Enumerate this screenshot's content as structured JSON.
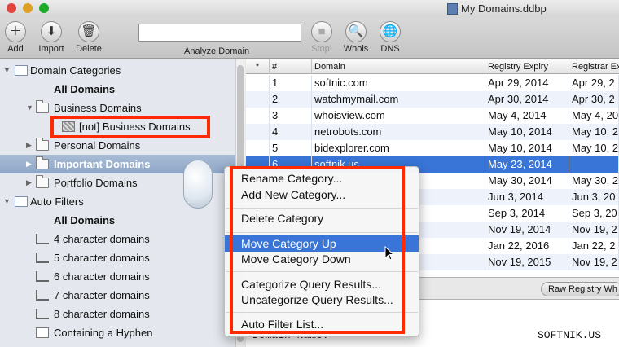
{
  "window": {
    "title": "My Domains.ddbp"
  },
  "toolbar": {
    "add_label": "Add",
    "import_label": "Import",
    "delete_label": "Delete",
    "analyze_value": "",
    "analyze_label": "Analyze Domain",
    "stop_label": "Stop!",
    "whois_label": "Whois",
    "dns_label": "DNS"
  },
  "sidebar": {
    "domain_categories": "Domain Categories",
    "all_domains": "All Domains",
    "business_domains": "Business Domains",
    "not_business_domains": "[not] Business Domains",
    "personal_domains": "Personal Domains",
    "important_domains": "Important Domains",
    "portfolio_domains": "Portfolio Domains",
    "auto_filters": "Auto Filters",
    "auto_all_domains": "All Domains",
    "four_char": "4 character domains",
    "five_char": "5 character domains",
    "six_char": "6 character domains",
    "seven_char": "7 character domains",
    "eight_char": "8 character domains",
    "hyphen": "Containing a Hyphen"
  },
  "table": {
    "headers": [
      "*",
      "#",
      "Domain",
      "Registry Expiry",
      "Registrar Ex"
    ],
    "rows": [
      {
        "num": "1",
        "domain": "softnic.com",
        "expiry": "Apr 29, 2014",
        "registrar": "Apr 29, 2"
      },
      {
        "num": "2",
        "domain": "watchmymail.com",
        "expiry": "Apr 30, 2014",
        "registrar": "Apr 30, 2"
      },
      {
        "num": "3",
        "domain": "whoisview.com",
        "expiry": "May 4, 2014",
        "registrar": "May 4, 20"
      },
      {
        "num": "4",
        "domain": "netrobots.com",
        "expiry": "May 10, 2014",
        "registrar": "May 10, 2"
      },
      {
        "num": "5",
        "domain": "bidexplorer.com",
        "expiry": "May 10, 2014",
        "registrar": "May 10, 2"
      },
      {
        "num": "6",
        "domain": "softnik.us",
        "expiry": "May 23, 2014",
        "registrar": ""
      },
      {
        "num": "",
        "domain": "",
        "expiry": "May 30, 2014",
        "registrar": "May 30, 2"
      },
      {
        "num": "",
        "domain": "",
        "expiry": "Jun 3, 2014",
        "registrar": "Jun 3, 20"
      },
      {
        "num": "",
        "domain": "",
        "expiry": "Sep 3, 2014",
        "registrar": "Sep 3, 20"
      },
      {
        "num": "",
        "domain": "",
        "expiry": "Nov 19, 2014",
        "registrar": "Nov 19, 2"
      },
      {
        "num": "",
        "domain": "",
        "expiry": "Jan 22, 2016",
        "registrar": "Jan 22, 2"
      },
      {
        "num": "",
        "domain": "",
        "expiry": "Nov 19, 2015",
        "registrar": "Nov 19, 2"
      }
    ]
  },
  "raw_registry_tab": "Raw Registry Wh",
  "whois": {
    "line1_label": "Domain Name:",
    "line1_value": "SOFTNIK.US"
  },
  "context_menu": {
    "rename": "Rename Category...",
    "add_new": "Add New Category...",
    "delete": "Delete Category",
    "move_up": "Move Category Up",
    "move_down": "Move Category Down",
    "categorize": "Categorize Query Results...",
    "uncategorize": "Uncategorize Query Results...",
    "auto_filter": "Auto Filter List..."
  },
  "colors": {
    "selection_blue": "#3875d7",
    "highlight_red": "#ff2a00",
    "sidebar_bg": "#e4e8ee"
  }
}
